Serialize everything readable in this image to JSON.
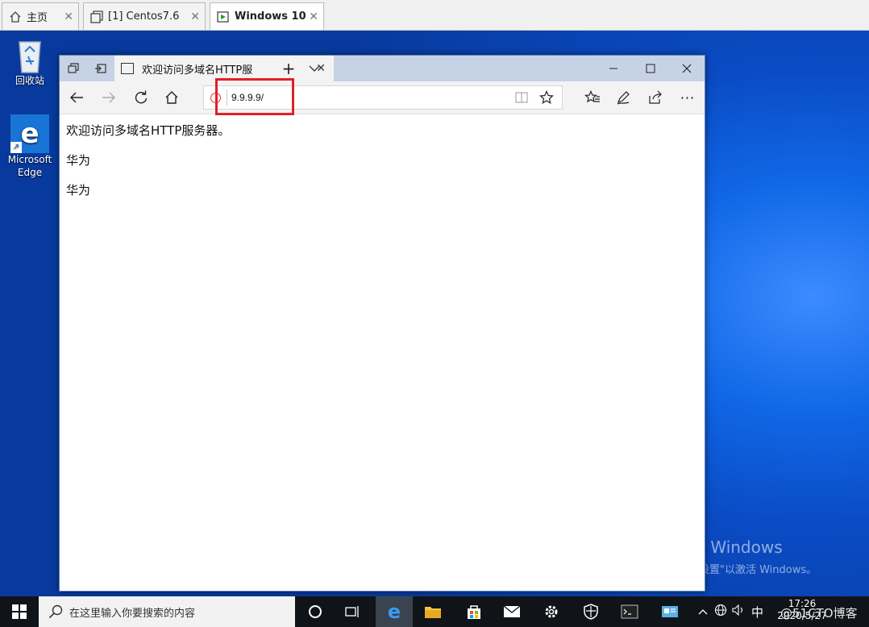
{
  "vm_tabs": [
    {
      "label": "主页",
      "icon": "home-icon"
    },
    {
      "label": "[1] Centos7.6",
      "icon": "vm-icon"
    },
    {
      "label": "Windows 10",
      "icon": "vm-running-icon"
    }
  ],
  "desktop": {
    "icons": [
      {
        "label": "回收站",
        "icon": "recycle-bin-icon"
      },
      {
        "label": "Microsoft Edge",
        "icon": "edge-icon"
      }
    ],
    "watermark_title": "激活 Windows",
    "watermark_sub": "转到\"设置\"以激活 Windows。"
  },
  "browser": {
    "tab_title": "欢迎访问多域名HTTP服",
    "address": "9.9.9.9/",
    "content_lines": [
      "欢迎访问多域名HTTP服务器。",
      "华为",
      "华为"
    ]
  },
  "taskbar": {
    "search_placeholder": "在这里输入你要搜索的内容",
    "ime": "中",
    "time": "17:26",
    "date": "2020/5/27",
    "brand": "@51CTO博客"
  },
  "colors": {
    "highlight": "#e0202a",
    "desktop_blue": "#0a4bc4"
  }
}
